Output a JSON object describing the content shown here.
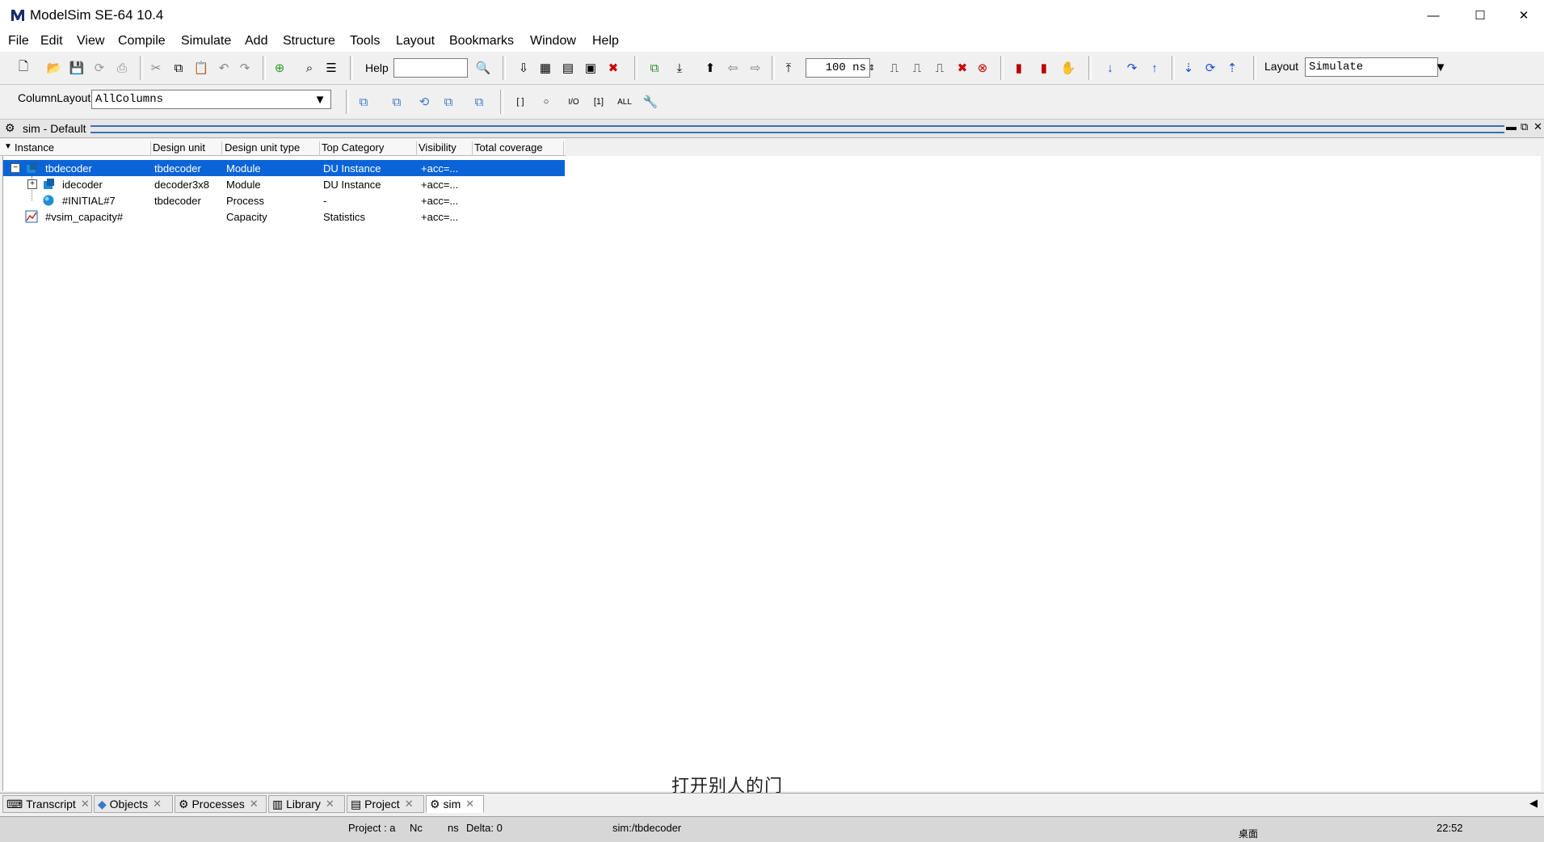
{
  "window": {
    "title": "ModelSim SE-64 10.4",
    "controls": [
      "—",
      "☐",
      "✕"
    ]
  },
  "menu": [
    "File",
    "Edit",
    "View",
    "Compile",
    "Simulate",
    "Add",
    "Structure",
    "Tools",
    "Layout",
    "Bookmarks",
    "Window",
    "Help"
  ],
  "toolbar": {
    "help_label": "Help",
    "help_value": "",
    "run_length": "100 ns",
    "layout_label": "Layout",
    "layout_value": "Simulate",
    "column_layout_label": "ColumnLayout",
    "column_layout_value": "AllColumns"
  },
  "panel": {
    "title": "sim - Default"
  },
  "columns": [
    "Instance",
    "Design unit",
    "Design unit type",
    "Top Category",
    "Visibility",
    "Total coverage"
  ],
  "rows": [
    {
      "instance": "tbdecoder",
      "design_unit": "tbdecoder",
      "unit_type": "Module",
      "category": "DU Instance",
      "visibility": "+acc=...",
      "coverage": ""
    },
    {
      "instance": "idecoder",
      "design_unit": "decoder3x8",
      "unit_type": "Module",
      "category": "DU Instance",
      "visibility": "+acc=...",
      "coverage": ""
    },
    {
      "instance": "#INITIAL#7",
      "design_unit": "tbdecoder",
      "unit_type": "Process",
      "category": "-",
      "visibility": "+acc=...",
      "coverage": ""
    },
    {
      "instance": "#vsim_capacity#",
      "design_unit": "",
      "unit_type": "Capacity",
      "category": "Statistics",
      "visibility": "+acc=...",
      "coverage": ""
    }
  ],
  "tabs": [
    "Transcript",
    "Objects",
    "Processes",
    "Library",
    "Project",
    "sim"
  ],
  "status": {
    "project": "Project : a",
    "now": "Nc",
    "now_unit": "ns",
    "delta": "Delta: 0",
    "context": "sim:/tbdecoder",
    "time": "22:52",
    "desktop": "桌面"
  },
  "subtitle": "打开别人的门",
  "colors": {
    "selection": "#0a64d8",
    "header_lines": "#3b6fb6"
  }
}
